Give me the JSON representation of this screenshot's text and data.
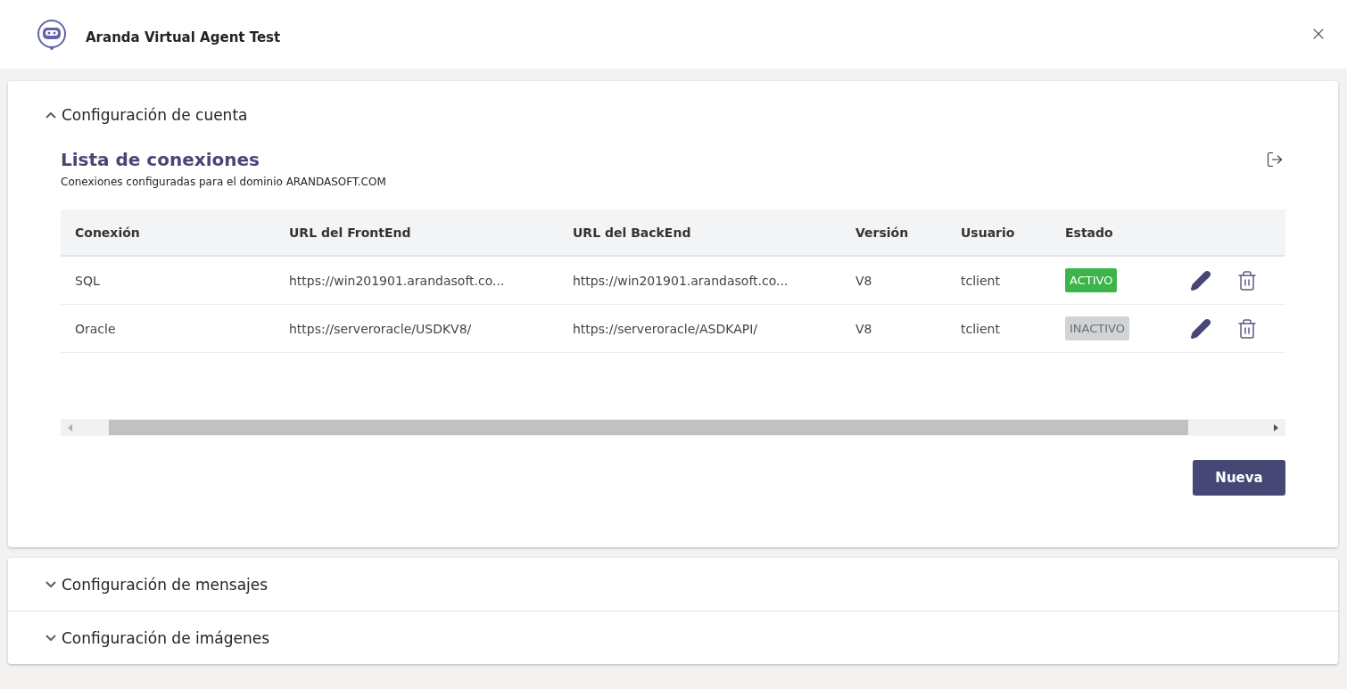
{
  "window": {
    "title": "Aranda Virtual Agent Test"
  },
  "sections": [
    {
      "title": "Configuración de cuenta",
      "expanded": true
    },
    {
      "title": "Configuración de mensajes",
      "expanded": false
    },
    {
      "title": "Configuración de imágenes",
      "expanded": false
    }
  ],
  "connections": {
    "title": "Lista de conexiones",
    "subtitle": "Conexiones configuradas para el dominio ARANDASOFT.COM",
    "columns": [
      "Conexión",
      "URL del FrontEnd",
      "URL del BackEnd",
      "Versión",
      "Usuario",
      "Estado"
    ],
    "rows": [
      {
        "cells": [
          "SQL",
          "https://win201901.arandasoft.co...",
          "https://win201901.arandasoft.co...",
          "V8",
          "tclient"
        ],
        "status": "ACTIVO",
        "active": true
      },
      {
        "cells": [
          "Oracle",
          "https://serveroracle/USDKV8/",
          "https://serveroracle/ASDKAPI/",
          "V8",
          "tclient"
        ],
        "status": "INACTIVO",
        "active": false
      }
    ],
    "new_button": "Nueva"
  }
}
